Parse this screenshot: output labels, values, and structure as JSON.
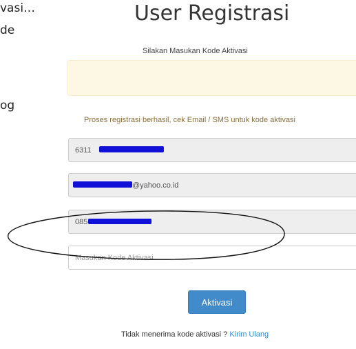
{
  "left_fragments": {
    "line1": "vasi…",
    "line2": "de",
    "line3": "og"
  },
  "header": {
    "title": "User Registrasi",
    "subtitle": "Silakan Masukan Kode Aktivasi"
  },
  "alert": {
    "message": "Proses registrasi berhasil, cek Email / SMS untuk kode aktivasi"
  },
  "fields": {
    "id_prefix": "6311",
    "email_suffix": "@yahoo.co.id",
    "phone_prefix": "085",
    "code_placeholder": "Masukan Kode Aktivasi"
  },
  "actions": {
    "activate_label": "Aktivasi",
    "resend_prompt": "Tidak menerima kode aktivasi ? ",
    "resend_link": "Kirim Ulang"
  },
  "colors": {
    "primary_button": "#428bca",
    "alert_background": "#fcf8e3",
    "link": "#2a8fd8",
    "redaction": "#1010d8"
  }
}
